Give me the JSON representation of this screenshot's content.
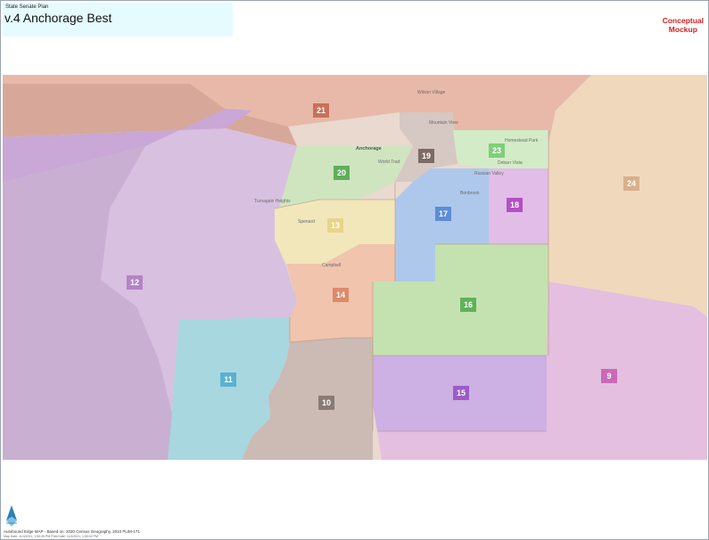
{
  "header": {
    "subtitle": "State Senate Plan",
    "title": "v.4 Anchorage Best",
    "mockup_line1": "Conceptual",
    "mockup_line2": "Mockup"
  },
  "map": {
    "places": {
      "wilson_village": "Wilson Village",
      "mountain_view": "Mountain View",
      "anchorage": "Anchorage",
      "world_trade": "World Trad",
      "turnagain_heights": "Turnagain Heights",
      "spenard": "Spenard",
      "campbell": "Campbell",
      "bonbrook": "Bonbrook",
      "russian_valley": "Russian Valley",
      "homestead_park": "Homestead Park",
      "debarr_vista": "Debarr Vista"
    },
    "districts": [
      {
        "id": "21",
        "color": "#c8705a"
      },
      {
        "id": "19",
        "color": "#7d6a64"
      },
      {
        "id": "20",
        "color": "#5fae5a"
      },
      {
        "id": "23",
        "color": "#7fcf7a"
      },
      {
        "id": "17",
        "color": "#5d8dd6"
      },
      {
        "id": "18",
        "color": "#b44fc4"
      },
      {
        "id": "24",
        "color": "#d8b08a"
      },
      {
        "id": "13",
        "color": "#e8d48a"
      },
      {
        "id": "12",
        "color": "#b483c8"
      },
      {
        "id": "14",
        "color": "#dc8a6a"
      },
      {
        "id": "16",
        "color": "#5fb25a"
      },
      {
        "id": "9",
        "color": "#c86ab8"
      },
      {
        "id": "11",
        "color": "#5ab2d0"
      },
      {
        "id": "10",
        "color": "#8a7a74"
      },
      {
        "id": "15",
        "color": "#9c5cc8"
      }
    ]
  },
  "footer": {
    "line1": "Autobound Edge MAP - Based on:  2020 Census Geography, 2010 PLIM-171",
    "line2": "Map Date: 11/4/2021, 1:50:26 PM  Print Date: 11/4/2021, 1:50:42 PM"
  }
}
